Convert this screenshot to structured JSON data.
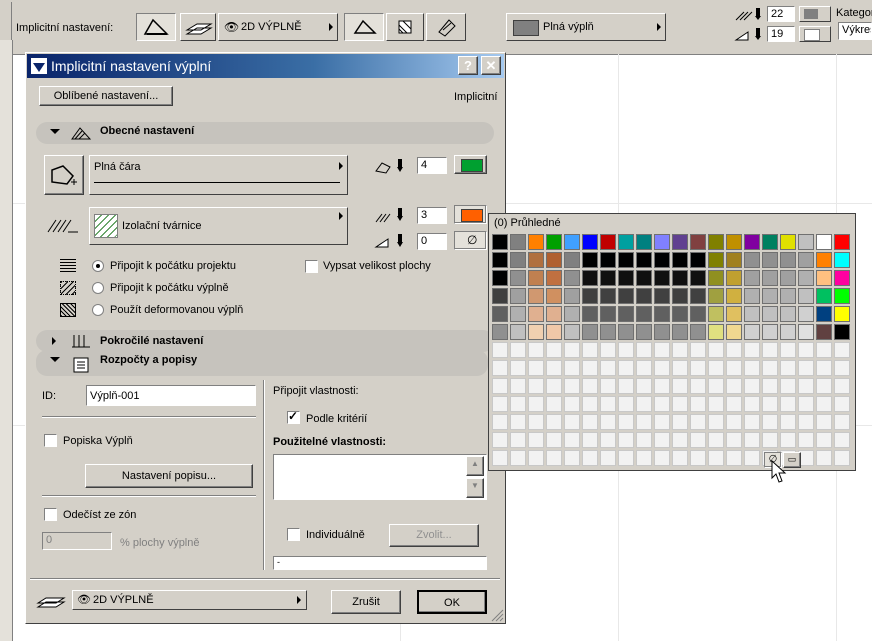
{
  "toolbar": {
    "label": "Implicitní nastavení:",
    "fill_type_dropdown": "2D VÝPLNĚ",
    "fill_dropdown": "Plná výplň",
    "pen_top": "22",
    "pen_bottom": "19",
    "category_label": "Kategor",
    "category_value": "Výkres"
  },
  "dialog": {
    "title": "Implicitní nastavení výplní",
    "help_label": "?",
    "close_label": "✕",
    "favorites_button": "Oblíbené nastavení...",
    "mode_label": "Implicitní",
    "general": {
      "heading": "Obecné nastavení",
      "line_type": "Plná čára",
      "outline_pen": "4",
      "fill_name": "Izolační tvárnice",
      "fill_pen": "3",
      "background_pen": "0",
      "radio_options": [
        "Připojit k počátku projektu",
        "Připojit k počátku výplně",
        "Použít deformovanou výplň"
      ],
      "selected_radio": 0,
      "area_checkbox": "Vypsat velikost plochy"
    },
    "advanced": {
      "heading": "Pokročilé nastavení"
    },
    "listing": {
      "heading": "Rozpočty a popisy",
      "id_label": "ID:",
      "id_value": "Výplň-001",
      "label_checkbox": "Popiska Výplň",
      "label_settings_button": "Nastavení popisu...",
      "subtract_checkbox": "Odečíst ze zón",
      "percent_value": "0",
      "percent_label": "% plochy výplně",
      "attach_props_label": "Připojit vlastnosti:",
      "by_criteria_checkbox": "Podle kritérií",
      "by_criteria_checked": true,
      "available_props_label": "Použitelné vlastnosti:",
      "individual_checkbox": "Individuálně",
      "choose_button": "Zvolit...",
      "progress_text": "-"
    },
    "footer": {
      "layer_dropdown": "2D VÝPLNĚ",
      "cancel_button": "Zrušit",
      "ok_button": "OK"
    }
  },
  "palette": {
    "header": "(0) Průhledné",
    "colors": [
      [
        "#000000",
        "#808080",
        "#ff8000",
        "#00a000",
        "#40a0ff",
        "#0000ff",
        "#c00000",
        "#00a0a0",
        "#008080",
        "#8080ff",
        "#604090",
        "#804040",
        "#808000",
        "#c09000",
        "#8000a0",
        "#008060",
        "#e0e000",
        "#c0c0c0",
        "#ffffff",
        "#ff0000"
      ],
      [
        "#000000",
        "#808080",
        "#b07040",
        "#b06030",
        "#808080",
        "#000000",
        "#000000",
        "#000000",
        "#000000",
        "#000000",
        "#000000",
        "#000000",
        "#808000",
        "#a08020",
        "#909090",
        "#909090",
        "#909090",
        "#a0a0a0",
        "#ff8000",
        "#00ffff"
      ],
      [
        "#000000",
        "#909090",
        "#c08050",
        "#c07040",
        "#909090",
        "#101010",
        "#101010",
        "#101010",
        "#101010",
        "#101010",
        "#101010",
        "#101010",
        "#909020",
        "#c0a030",
        "#a0a0a0",
        "#a0a0a0",
        "#a0a0a0",
        "#b0b0b0",
        "#ffc080",
        "#ff00a0"
      ],
      [
        "#404040",
        "#a0a0a0",
        "#d09870",
        "#d09060",
        "#a0a0a0",
        "#404040",
        "#404040",
        "#404040",
        "#404040",
        "#404040",
        "#404040",
        "#404040",
        "#a0a040",
        "#d0b040",
        "#b0b0b0",
        "#b0b0b0",
        "#b0b0b0",
        "#c0c0c0",
        "#00c060",
        "#00ff00"
      ],
      [
        "#606060",
        "#b0b0b0",
        "#e0b090",
        "#e0b090",
        "#b0b0b0",
        "#606060",
        "#606060",
        "#606060",
        "#606060",
        "#606060",
        "#606060",
        "#606060",
        "#c0c060",
        "#e0c060",
        "#c0c0c0",
        "#c0c0c0",
        "#c0c0c0",
        "#d0d0d0",
        "#004080",
        "#ffff00"
      ],
      [
        "#909090",
        "#c0c0c0",
        "#f0d0b0",
        "#f0c8a8",
        "#c0c0c0",
        "#909090",
        "#909090",
        "#909090",
        "#909090",
        "#909090",
        "#909090",
        "#909090",
        "#e0e080",
        "#f0d890",
        "#d0d0d0",
        "#d0d0d0",
        "#d0d0d0",
        "#e0e0e0",
        "#604040",
        "#000000"
      ]
    ],
    "empty_rows": 7,
    "icon_left": "no-fill-icon",
    "icon_right": "monitor-icon"
  }
}
